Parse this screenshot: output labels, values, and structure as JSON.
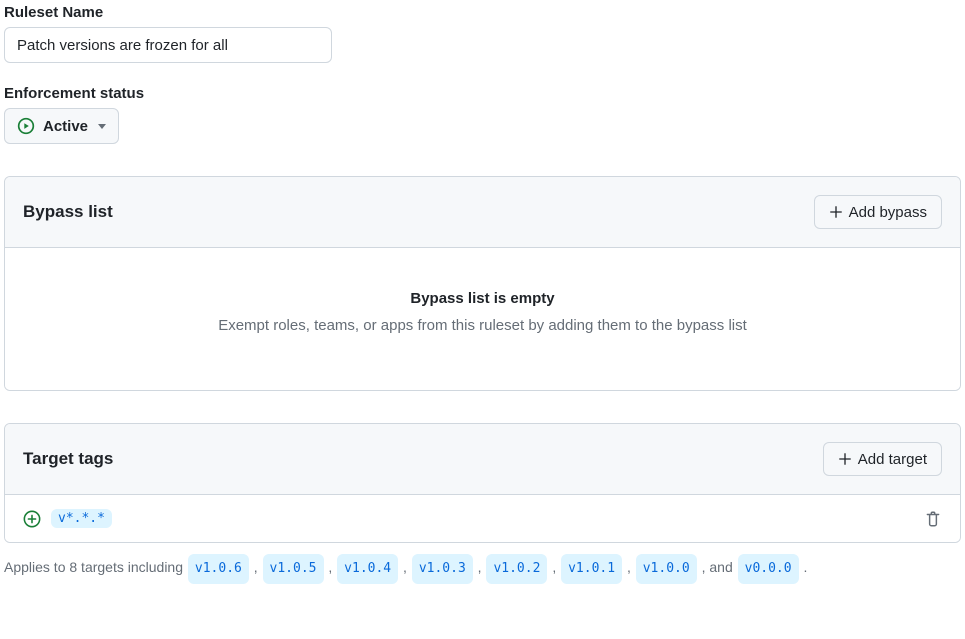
{
  "ruleset": {
    "name_label": "Ruleset Name",
    "name_value": "Patch versions are frozen for all"
  },
  "enforcement": {
    "label": "Enforcement status",
    "value": "Active"
  },
  "bypass": {
    "header": "Bypass list",
    "add_button": "Add bypass",
    "empty_title": "Bypass list is empty",
    "empty_desc": "Exempt roles, teams, or apps from this ruleset by adding them to the bypass list"
  },
  "targets": {
    "header": "Target tags",
    "add_button": "Add target",
    "pattern": "v*.*.*",
    "applies_prefix": "Applies to 8 targets including",
    "tag_list": [
      "v1.0.6",
      "v1.0.5",
      "v1.0.4",
      "v1.0.3",
      "v1.0.2",
      "v1.0.1",
      "v1.0.0"
    ],
    "applies_join_last": ", and",
    "last_tag": "v0.0.0",
    "applies_suffix": "."
  },
  "colors": {
    "accent_green": "#1a7f37",
    "accent_blue": "#0969da"
  }
}
